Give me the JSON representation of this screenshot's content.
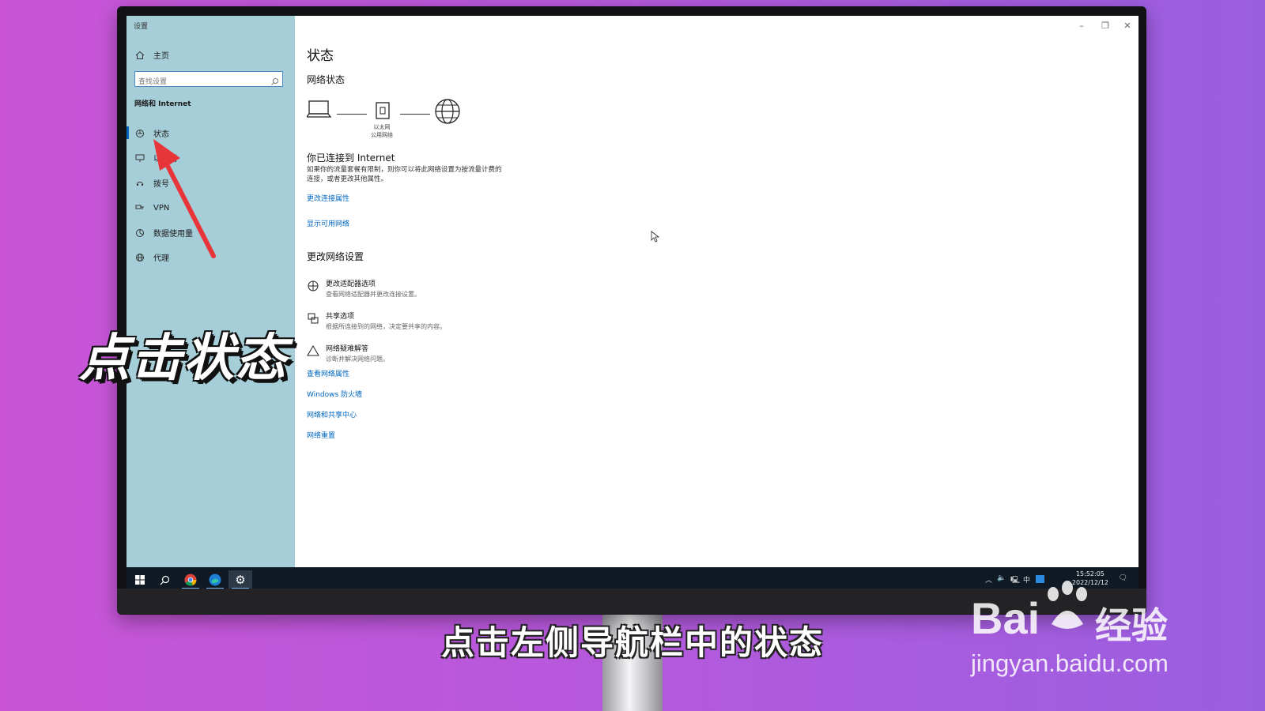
{
  "window": {
    "title": "设置"
  },
  "sidebar": {
    "home": "主页",
    "search_placeholder": "查找设置",
    "section": "网络和 Internet",
    "items": [
      {
        "label": "状态",
        "icon": "status-icon"
      },
      {
        "label": "以太网",
        "icon": "ethernet-icon"
      },
      {
        "label": "拨号",
        "icon": "dialup-icon"
      },
      {
        "label": "VPN",
        "icon": "vpn-icon"
      },
      {
        "label": "数据使用量",
        "icon": "data-usage-icon"
      },
      {
        "label": "代理",
        "icon": "globe-icon"
      }
    ]
  },
  "main": {
    "title": "状态",
    "network_status": "网络状态",
    "diagram": {
      "device_caption_1": "以太网",
      "device_caption_2": "公用网络"
    },
    "connected_title": "你已连接到 Internet",
    "connected_desc_1": "如果你的流量套餐有限制，则你可以将此网络设置为按流量计费的",
    "connected_desc_2": "连接，或者更改其他属性。",
    "link_change_props": "更改连接属性",
    "link_show_networks": "显示可用网络",
    "change_settings_title": "更改网络设置",
    "options": [
      {
        "title": "更改适配器选项",
        "desc": "查看网络适配器并更改连接设置。",
        "icon": "adapter-icon"
      },
      {
        "title": "共享选项",
        "desc": "根据所连接到的网络，决定要共享的内容。",
        "icon": "sharing-icon"
      },
      {
        "title": "网络疑难解答",
        "desc": "诊断并解决网络问题。",
        "icon": "warning-icon"
      }
    ],
    "links": [
      "查看网络属性",
      "Windows 防火墙",
      "网络和共享中心",
      "网络重置"
    ]
  },
  "taskbar": {
    "tray_ime": "中",
    "time": "15:52:05",
    "date": "2022/12/12"
  },
  "overlay": {
    "big_text": "点击状态",
    "subtitle": "点击左侧导航栏中的状态",
    "watermark_brand": "Bai",
    "watermark_brand2": "经验",
    "watermark_url": "jingyan.baidu.com"
  },
  "colors": {
    "accent": "#0067c0",
    "sidebar_bg": "#a6ced9",
    "arrow": "#e8353a",
    "taskbar": "#0f1a24"
  }
}
